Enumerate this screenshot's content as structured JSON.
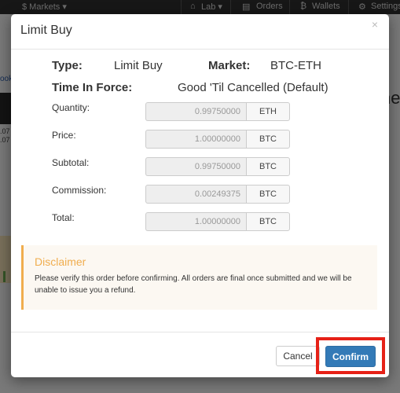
{
  "background": {
    "nav": {
      "markets": "$ Markets ▾",
      "lab": "Lab ▾",
      "orders": "Orders",
      "wallets": "Wallets",
      "settings": "Settings"
    },
    "side_values": [
      ".07",
      ".07"
    ],
    "book_text": "ook",
    "big_letters": "ne"
  },
  "modal": {
    "title": "Limit Buy",
    "close_symbol": "×",
    "summary": {
      "type_label": "Type:",
      "type_value": "Limit Buy",
      "market_label": "Market:",
      "market_value": "BTC-ETH",
      "tif_label": "Time In Force:",
      "tif_value": "Good 'Til Cancelled (Default)"
    },
    "rows": [
      {
        "label": "Quantity:",
        "value": "0.99750000",
        "unit": "ETH"
      },
      {
        "label": "Price:",
        "value": "1.00000000",
        "unit": "BTC"
      },
      {
        "label": "Subtotal:",
        "value": "0.99750000",
        "unit": "BTC"
      },
      {
        "label": "Commission:",
        "value": "0.00249375",
        "unit": "BTC"
      },
      {
        "label": "Total:",
        "value": "1.00000000",
        "unit": "BTC"
      }
    ],
    "disclaimer": {
      "title": "Disclaimer",
      "text": "Please verify this order before confirming. All orders are final once submitted and we will be unable to issue you a refund."
    },
    "buttons": {
      "cancel": "Cancel",
      "confirm": "Confirm"
    }
  },
  "colors": {
    "confirm_bg": "#337ab7",
    "disclaimer_accent": "#f0ad4e",
    "highlight": "#e62117"
  }
}
